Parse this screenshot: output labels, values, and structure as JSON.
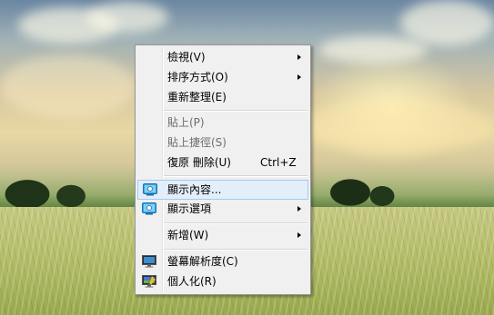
{
  "context_menu": {
    "items": [
      {
        "label": "檢視(V)",
        "submenu": true,
        "enabled": true
      },
      {
        "label": "排序方式(O)",
        "submenu": true,
        "enabled": true
      },
      {
        "label": "重新整理(E)",
        "submenu": false,
        "enabled": true
      },
      {
        "label": "貼上(P)",
        "submenu": false,
        "enabled": false
      },
      {
        "label": "貼上捷徑(S)",
        "submenu": false,
        "enabled": false
      },
      {
        "label": "復原 刪除(U)",
        "shortcut": "Ctrl+Z",
        "submenu": false,
        "enabled": true
      },
      {
        "label": "顯示內容...",
        "icon": "display-settings-icon",
        "submenu": false,
        "enabled": true,
        "highlighted": true
      },
      {
        "label": "顯示選項",
        "icon": "display-settings-icon",
        "submenu": true,
        "enabled": true
      },
      {
        "label": "新增(W)",
        "submenu": true,
        "enabled": true
      },
      {
        "label": "螢幕解析度(C)",
        "icon": "monitor-icon",
        "submenu": false,
        "enabled": true
      },
      {
        "label": "個人化(R)",
        "icon": "personalize-icon",
        "submenu": false,
        "enabled": true
      }
    ]
  },
  "colors": {
    "menu_background": "#f0f0f0",
    "highlight_background": "#e3eefb",
    "highlight_border": "#a6c8ef",
    "disabled_text": "#6d6d6d"
  }
}
